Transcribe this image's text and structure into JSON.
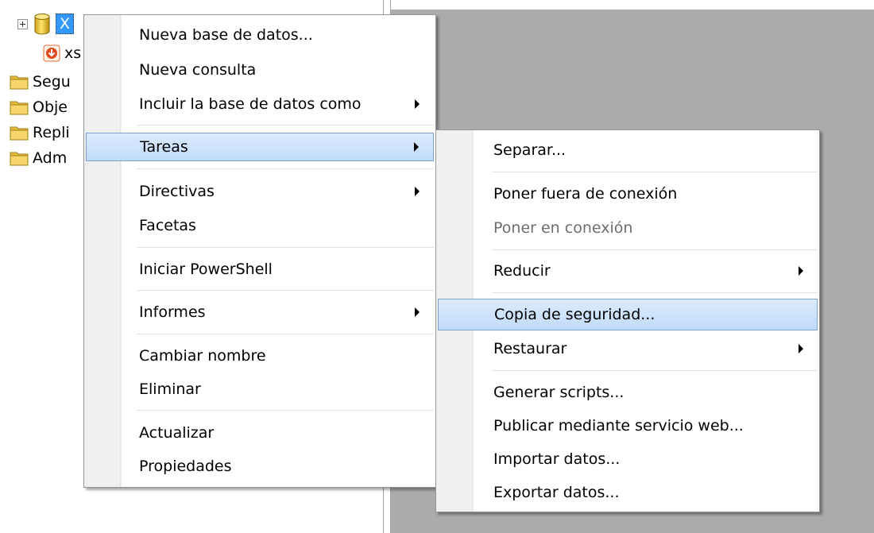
{
  "tree": {
    "selected_db_label": "X",
    "backup_label": "xs",
    "folders": [
      "Segu",
      "Obje",
      "Repli",
      "Adm"
    ]
  },
  "main_menu": {
    "items": [
      {
        "label": "Nueva base de datos...",
        "submenu": false
      },
      {
        "label": "Nueva consulta",
        "submenu": false
      },
      {
        "label": "Incluir la base de datos como",
        "submenu": true
      },
      {
        "label": "Tareas",
        "submenu": true,
        "highlighted": true
      },
      {
        "label": "Directivas",
        "submenu": true
      },
      {
        "label": "Facetas",
        "submenu": false
      },
      {
        "label": "Iniciar PowerShell",
        "submenu": false
      },
      {
        "label": "Informes",
        "submenu": true
      },
      {
        "label": "Cambiar nombre",
        "submenu": false
      },
      {
        "label": "Eliminar",
        "submenu": false
      },
      {
        "label": "Actualizar",
        "submenu": false
      },
      {
        "label": "Propiedades",
        "submenu": false
      }
    ]
  },
  "tasks_menu": {
    "items": [
      {
        "label": "Separar...",
        "submenu": false
      },
      {
        "label": "Poner fuera de conexión",
        "submenu": false
      },
      {
        "label": "Poner en conexión",
        "submenu": false,
        "disabled": true
      },
      {
        "label": "Reducir",
        "submenu": true
      },
      {
        "label": "Copia de seguridad...",
        "submenu": false,
        "highlighted": true
      },
      {
        "label": "Restaurar",
        "submenu": true
      },
      {
        "label": "Generar scripts...",
        "submenu": false
      },
      {
        "label": "Publicar mediante servicio web...",
        "submenu": false
      },
      {
        "label": "Importar datos...",
        "submenu": false
      },
      {
        "label": "Exportar datos...",
        "submenu": false
      }
    ]
  },
  "colors": {
    "highlight_border": "#7da2ce",
    "highlight_fill": "#c1dbfc",
    "selection_blue": "#3399ff",
    "content_gray": "#ababab",
    "disabled_text": "#6d6d6d"
  }
}
